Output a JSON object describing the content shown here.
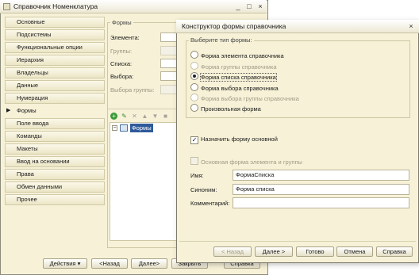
{
  "catalog_window": {
    "title": "Справочник Номенклатура",
    "window_buttons": {
      "minimize": "_",
      "maximize": "□",
      "close": "×"
    },
    "nav_items": [
      {
        "label": "Основные"
      },
      {
        "label": "Подсистемы"
      },
      {
        "label": "Функциональные опции"
      },
      {
        "label": "Иерархия"
      },
      {
        "label": "Владельцы"
      },
      {
        "label": "Данные"
      },
      {
        "label": "Нумерация"
      },
      {
        "label": "Формы"
      },
      {
        "label": "Поле ввода"
      },
      {
        "label": "Команды"
      },
      {
        "label": "Макеты"
      },
      {
        "label": "Ввод на основании"
      },
      {
        "label": "Права"
      },
      {
        "label": "Обмен данными"
      },
      {
        "label": "Прочее"
      }
    ],
    "active_nav": "Формы",
    "forms_group": {
      "title": "Формы",
      "fields": [
        {
          "label": "Элемента:",
          "enabled": true
        },
        {
          "label": "Группы:",
          "enabled": false
        },
        {
          "label": "Списка:",
          "enabled": true
        },
        {
          "label": "Выбора:",
          "enabled": true
        },
        {
          "label": "Выбора группы:",
          "enabled": false
        }
      ],
      "tree_item": "Формы"
    },
    "buttons": {
      "actions": "Действия",
      "back": "<Назад",
      "next": "Далее>",
      "close": "Закрыть",
      "help": "Справка"
    }
  },
  "designer_dialog": {
    "title": "Конструктор формы справочника",
    "close_glyph": "×",
    "type_group_title": "Выберите тип формы:",
    "form_types": [
      {
        "label": "Форма элемента справочника",
        "selected": false,
        "enabled": true
      },
      {
        "label": "Форма группы справочника",
        "selected": false,
        "enabled": false
      },
      {
        "label": "Форма списка справочника",
        "selected": true,
        "enabled": true
      },
      {
        "label": "Форма выбора справочника",
        "selected": false,
        "enabled": true
      },
      {
        "label": "Форма выбора группы справочника",
        "selected": false,
        "enabled": false
      },
      {
        "label": "Произвольная форма",
        "selected": false,
        "enabled": true
      }
    ],
    "set_main_checkbox": {
      "label": "Назначить форму основной",
      "checked": true
    },
    "main_elem_group_checkbox": {
      "label": "Основная форма элемента и группы",
      "checked": false
    },
    "fields": {
      "name_label": "Имя:",
      "name_value": "ФормаСписка",
      "synonym_label": "Синоним:",
      "synonym_value": "Форма списка",
      "comment_label": "Комментарий:",
      "comment_value": ""
    },
    "buttons": {
      "back": "< Назад",
      "next": "Далее >",
      "done": "Готово",
      "cancel": "Отмена",
      "help": "Справка"
    }
  }
}
